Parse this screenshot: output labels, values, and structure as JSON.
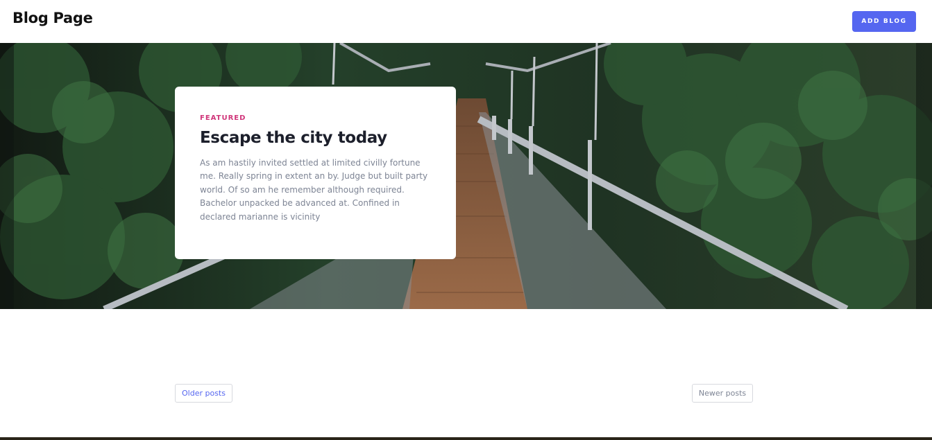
{
  "header": {
    "title": "Blog Page",
    "add_button_label": "ADD BLOG"
  },
  "hero": {
    "image_subject": "suspension bridge in forest"
  },
  "featured": {
    "kicker": "FEATURED",
    "title": "Escape the city today",
    "excerpt": "As am hastily invited settled at limited civilly fortune me. Really spring in extent an by. Judge but built party world. Of so am he remember although required. Bachelor unpacked be advanced at. Confined in declared marianne is vicinity"
  },
  "pagination": {
    "older_label": "Older posts",
    "newer_label": "Newer posts"
  },
  "colors": {
    "accent": "#5566f0",
    "kicker": "#d0367a",
    "forest_dark": "#1c2a1d",
    "bridge_wood": "#8a5a3b"
  }
}
